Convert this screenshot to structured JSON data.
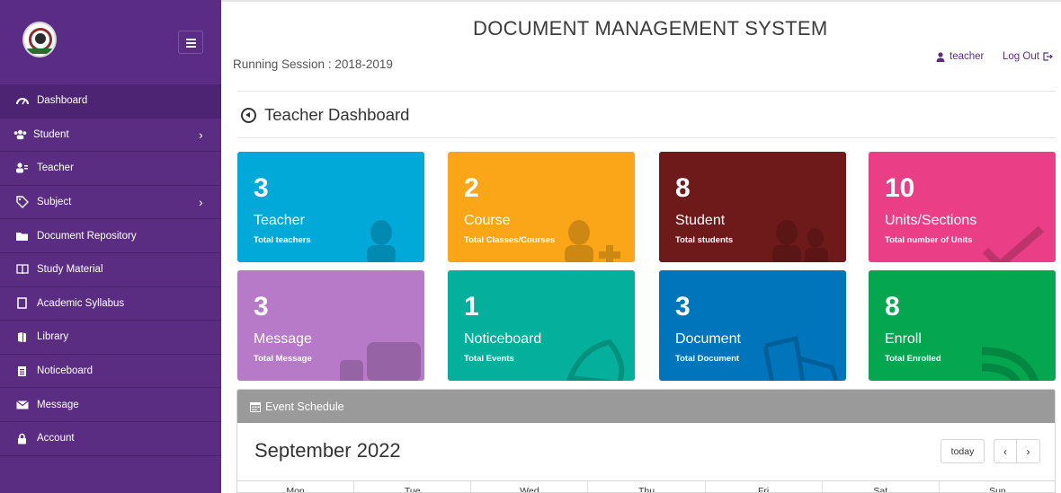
{
  "app": {
    "title": "DOCUMENT MANAGEMENT SYSTEM",
    "session": "Running Session : 2018-2019",
    "user": "teacher",
    "logout": "Log Out"
  },
  "sidebar": {
    "items": [
      {
        "label": "Dashboard",
        "icon": "dashboard-icon",
        "active": true
      },
      {
        "label": "Student",
        "icon": "users-icon",
        "submenu": true
      },
      {
        "label": "Teacher",
        "icon": "teacher-icon"
      },
      {
        "label": "Subject",
        "icon": "tags-icon",
        "submenu": true
      },
      {
        "label": "Document Repository",
        "icon": "folder-icon"
      },
      {
        "label": "Study Material",
        "icon": "book-icon"
      },
      {
        "label": "Academic Syllabus",
        "icon": "file-icon"
      },
      {
        "label": "Library",
        "icon": "library-icon"
      },
      {
        "label": "Noticeboard",
        "icon": "noticeboard-icon"
      },
      {
        "label": "Message",
        "icon": "envelope-icon"
      },
      {
        "label": "Account",
        "icon": "lock-icon"
      }
    ]
  },
  "page": {
    "heading": "Teacher Dashboard"
  },
  "tiles": [
    {
      "count": "3",
      "title": "Teacher",
      "subtitle": "Total teachers",
      "color": "#00a9d8"
    },
    {
      "count": "2",
      "title": "Course",
      "subtitle": "Total Classes/Courses",
      "color": "#fba619"
    },
    {
      "count": "8",
      "title": "Student",
      "subtitle": "Total students",
      "color": "#6f1a1a"
    },
    {
      "count": "10",
      "title": "Units/Sections",
      "subtitle": "Total number of Units",
      "color": "#ea3f86"
    },
    {
      "count": "3",
      "title": "Message",
      "subtitle": "Total Message",
      "color": "#b77ac8"
    },
    {
      "count": "1",
      "title": "Noticeboard",
      "subtitle": "Total Events",
      "color": "#04b09c"
    },
    {
      "count": "3",
      "title": "Document",
      "subtitle": "Total Document",
      "color": "#0075bb"
    },
    {
      "count": "8",
      "title": "Enroll",
      "subtitle": "Total Enrolled",
      "color": "#04a650"
    }
  ],
  "calendar": {
    "panel_title": "Event Schedule",
    "month": "September 2022",
    "today_label": "today",
    "prev": "‹",
    "next": "›",
    "days": [
      "Mon",
      "Tue",
      "Wed",
      "Thu",
      "Fri",
      "Sat",
      "Sun"
    ]
  },
  "colors": {
    "sidebar": "#5a2d82",
    "accent": "#5a2d82"
  }
}
